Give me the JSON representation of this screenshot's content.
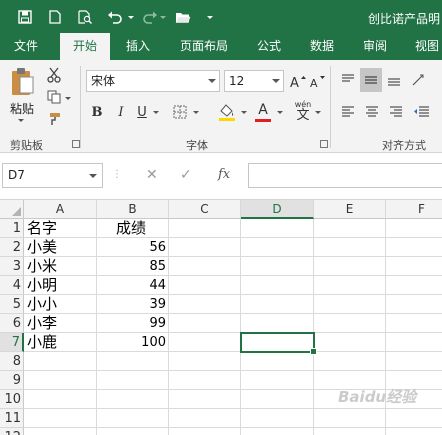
{
  "title_bar": {
    "doc_title": "创比诺产品明"
  },
  "tabs": [
    "文件",
    "开始",
    "插入",
    "页面布局",
    "公式",
    "数据",
    "审阅",
    "视图"
  ],
  "ribbon": {
    "paste_label": "粘贴",
    "clipboard_group": "剪贴板",
    "font_group": "字体",
    "align_group": "对齐方式",
    "font_name": "宋体",
    "font_size": "12",
    "bold": "B",
    "italic": "I",
    "underline": "U",
    "font_color_glyph": "A",
    "wen_glyph": "wén",
    "wen_char": "文"
  },
  "formula_bar": {
    "name_box": "D7",
    "fx": "fx"
  },
  "sheet": {
    "columns": [
      "A",
      "B",
      "C",
      "D",
      "E",
      "F"
    ],
    "rows": [
      "1",
      "2",
      "3",
      "4",
      "5",
      "6",
      "7",
      "8",
      "9",
      "10",
      "11",
      "12"
    ],
    "headers": {
      "name": "名字",
      "score": "成绩"
    },
    "records": [
      {
        "name": "小美",
        "score": "56"
      },
      {
        "name": "小米",
        "score": "85"
      },
      {
        "name": "小明",
        "score": "44"
      },
      {
        "name": "小小",
        "score": "39"
      },
      {
        "name": "小李",
        "score": "99"
      },
      {
        "name": "小鹿",
        "score": "100"
      }
    ],
    "selected_cell": "D7"
  },
  "watermark": "Baidu经验",
  "colors": {
    "accent": "#217346",
    "ribbon_bg": "#f3f3f3"
  }
}
